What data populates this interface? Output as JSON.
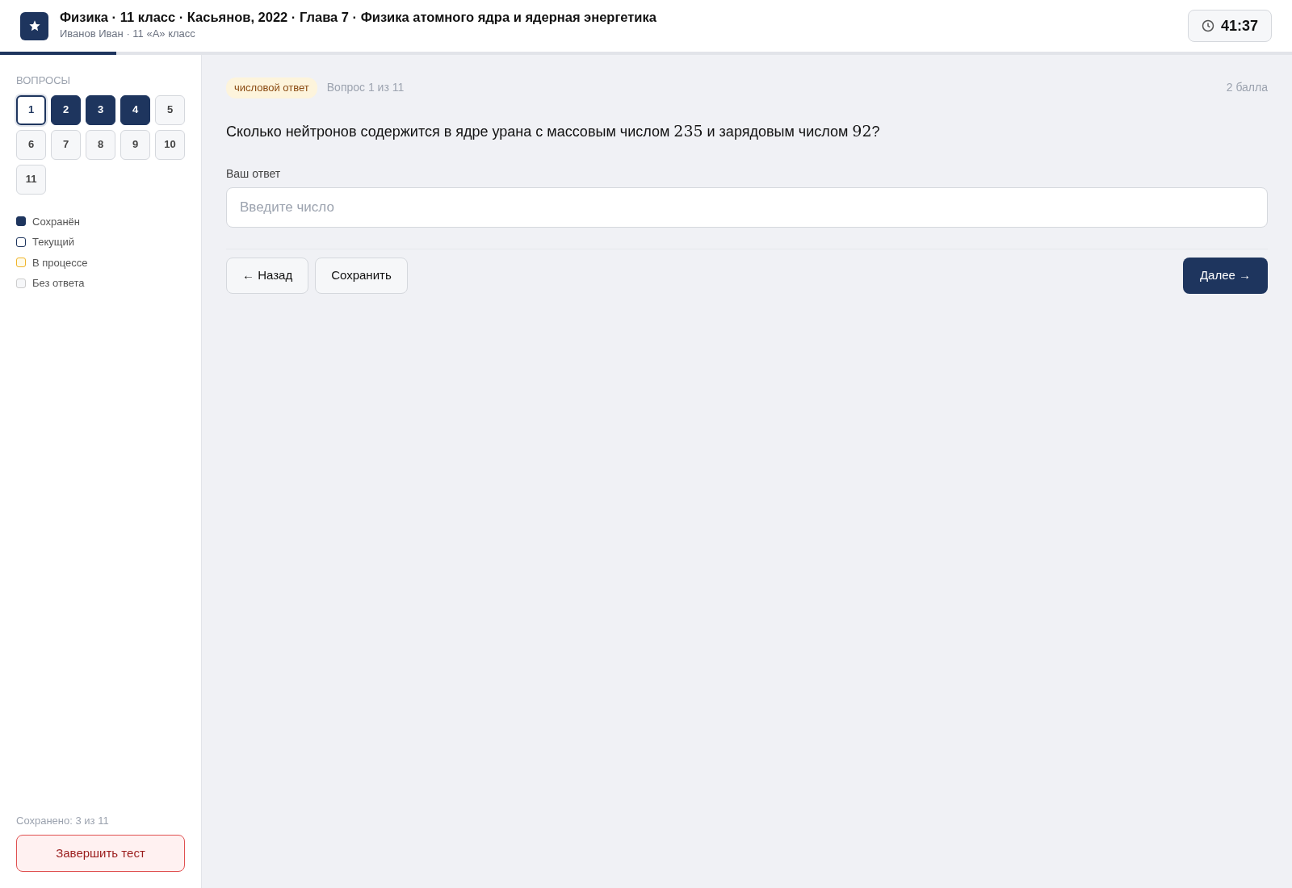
{
  "header": {
    "title": "Физика · 11 класс · Касьянов, 2022 · Глава 7 · Физика атомного ядра и ядерная энергетика",
    "subtitle": "Иванов Иван · 11 «А» класс",
    "timer": "41:37"
  },
  "progress": {
    "level": 0.09
  },
  "sidebar": {
    "heading": "ВОПРОСЫ",
    "questions": [
      {
        "label": "1",
        "saved": false,
        "selected": true
      },
      {
        "label": "2",
        "saved": true,
        "selected": false
      },
      {
        "label": "3",
        "saved": true,
        "selected": false
      },
      {
        "label": "4",
        "saved": true,
        "selected": false
      },
      {
        "label": "5",
        "saved": false,
        "selected": false
      },
      {
        "label": "6",
        "saved": false,
        "selected": false
      },
      {
        "label": "7",
        "saved": false,
        "selected": false
      },
      {
        "label": "8",
        "saved": false,
        "selected": false
      },
      {
        "label": "9",
        "saved": false,
        "selected": false
      },
      {
        "label": "10",
        "saved": false,
        "selected": false
      },
      {
        "label": "11",
        "saved": false,
        "selected": false
      }
    ],
    "legend": [
      {
        "label": "Сохранён",
        "kind": "saved"
      },
      {
        "label": "Текущий",
        "kind": "current"
      },
      {
        "label": "В процессе",
        "kind": "progress"
      },
      {
        "label": "Без ответа",
        "kind": "empty"
      }
    ],
    "summary": "Сохранено: 3 из 11",
    "finish_button": "Завершить тест"
  },
  "question": {
    "type_badge": "числовой ответ",
    "counter": "Вопрос 1 из 11",
    "points": "2 балла",
    "text": [
      {
        "kind": "text",
        "value": "Сколько нейтронов содержится в ядре урана с массовым числом "
      },
      {
        "kind": "math",
        "value": "235"
      },
      {
        "kind": "text",
        "value": " и зарядовым числом "
      },
      {
        "kind": "math",
        "value": "92"
      },
      {
        "kind": "text",
        "value": "?"
      }
    ],
    "answer_label": "Ваш ответ",
    "placeholder": "Введите число"
  },
  "buttons": {
    "back": "← Назад",
    "save": "Сохранить",
    "next": "Далее →"
  }
}
